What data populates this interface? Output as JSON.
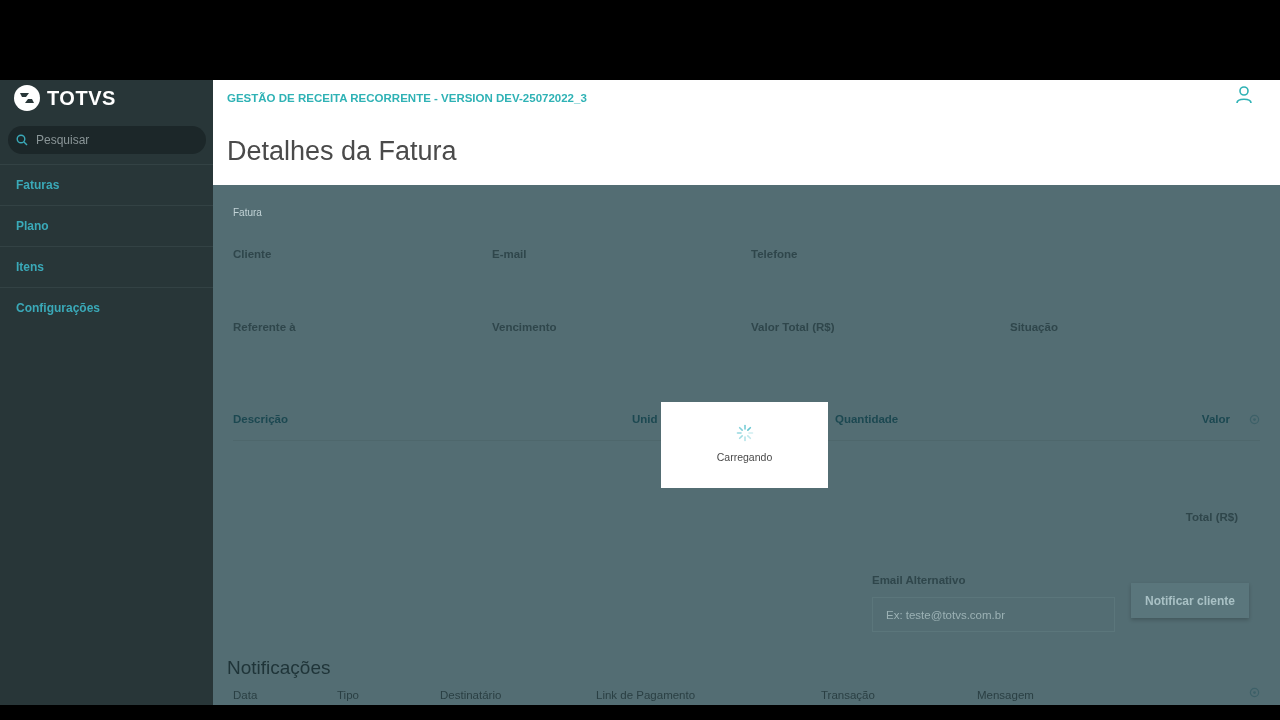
{
  "app": {
    "logo": "TOTVS"
  },
  "sidebar": {
    "search": {
      "placeholder": "Pesquisar"
    },
    "items": [
      {
        "label": "Faturas"
      },
      {
        "label": "Plano"
      },
      {
        "label": "Itens"
      },
      {
        "label": "Configurações"
      }
    ]
  },
  "header": {
    "subtitle": "GESTÃO DE RECEITA RECORRENTE - VERSION DEV-25072022_3",
    "title": "Detalhes da Fatura"
  },
  "invoice": {
    "section_label": "Fatura",
    "fields_row_1": [
      "Cliente",
      "E-mail",
      "Telefone"
    ],
    "fields_row_2": [
      "Referente à",
      "Vencimento",
      "Valor Total (R$)",
      "Situação"
    ]
  },
  "items_table": {
    "columns": [
      "Descrição",
      "Unid",
      "Quantidade",
      "Valor"
    ]
  },
  "total_label": "Total (R$)",
  "notify": {
    "label": "Email Alternativo",
    "placeholder": "Ex: teste@totvs.com.br",
    "button": "Notificar cliente"
  },
  "notifications": {
    "title": "Notificações",
    "columns": [
      "Data",
      "Tipo",
      "Destinatário",
      "Link de Pagamento",
      "Transação",
      "Mensagem"
    ]
  },
  "loading": {
    "text": "Carregando"
  }
}
